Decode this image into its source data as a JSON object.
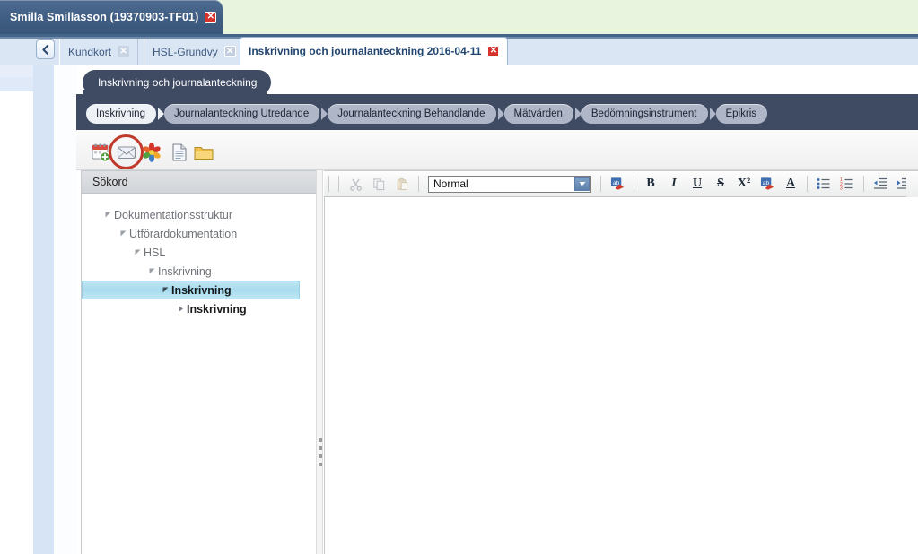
{
  "window": {
    "patient_tab": {
      "label": "Smilla Smillasson (19370903-TF01)",
      "close": "✕"
    }
  },
  "tabstrip": {
    "back_button": "back-chevron",
    "tabs": [
      {
        "label": "Kundkort",
        "close": "✕",
        "active": false
      },
      {
        "label": "HSL-Grundvy",
        "close": "✕",
        "active": false
      },
      {
        "label": "Inskrivning och journalanteckning 2016-04-11",
        "close": "✕",
        "active": true
      }
    ]
  },
  "header": {
    "title": "Inskrivning och journalanteckning",
    "steps": [
      {
        "label": "Inskrivning",
        "active": true
      },
      {
        "label": "Journalanteckning Utredande",
        "active": false
      },
      {
        "label": "Journalanteckning Behandlande",
        "active": false
      },
      {
        "label": "Mätvärden",
        "active": false
      },
      {
        "label": "Bedömningsinstrument",
        "active": false
      },
      {
        "label": "Epikris",
        "active": false
      }
    ]
  },
  "toolbar": {
    "icons": [
      {
        "name": "calendar-add-icon",
        "title": "Ny kalenderpost"
      },
      {
        "name": "envelope-icon",
        "title": "Meddelande",
        "highlighted": true
      },
      {
        "name": "asterisk-icon",
        "title": "Markera"
      },
      {
        "name": "document-icon",
        "title": "Dokument"
      },
      {
        "name": "folder-icon",
        "title": "Mapp"
      }
    ],
    "annotation_color": "#c0392b"
  },
  "tree_panel": {
    "header": "Sökord",
    "nodes": [
      {
        "label": "Dokumentationsstruktur",
        "indent": 0,
        "marker": "expanded",
        "selected": false,
        "strong": false
      },
      {
        "label": "Utförardokumentation",
        "indent": 1,
        "marker": "expanded",
        "selected": false,
        "strong": false
      },
      {
        "label": "HSL",
        "indent": 2,
        "marker": "expanded",
        "selected": false,
        "strong": false
      },
      {
        "label": "Inskrivning",
        "indent": 3,
        "marker": "expanded",
        "selected": false,
        "strong": false
      },
      {
        "label": "Inskrivning",
        "indent": 4,
        "marker": "expanded",
        "selected": true,
        "strong": true
      },
      {
        "label": "Inskrivning",
        "indent": 5,
        "marker": "collapsed",
        "selected": false,
        "strong": true
      }
    ]
  },
  "editor": {
    "style_select": {
      "value": "Normal",
      "placeholder": "Normal"
    },
    "buttons": [
      {
        "name": "cut-button",
        "glyph": "✂",
        "dim": true
      },
      {
        "name": "copy-button",
        "glyph": "❐",
        "dim": true
      },
      {
        "name": "paste-button",
        "glyph": "📋",
        "dim": true
      },
      {
        "name": "spellcheck-button",
        "glyph": "ab",
        "dim": false
      },
      {
        "name": "bold-button",
        "glyph": "B",
        "dim": false
      },
      {
        "name": "italic-button",
        "glyph": "I",
        "dim": false
      },
      {
        "name": "underline-button",
        "glyph": "U",
        "dim": false
      },
      {
        "name": "strikethrough-button",
        "glyph": "S",
        "dim": false
      },
      {
        "name": "superscript-button",
        "glyph": "X²",
        "dim": false
      },
      {
        "name": "highlight-color-button",
        "glyph": "ab",
        "dim": false
      },
      {
        "name": "font-color-button",
        "glyph": "A",
        "dim": false
      },
      {
        "name": "bullet-list-button",
        "glyph": "•≡",
        "dim": false
      },
      {
        "name": "numbered-list-button",
        "glyph": "1≡",
        "dim": false
      },
      {
        "name": "decrease-indent-button",
        "glyph": "⇤",
        "dim": false
      },
      {
        "name": "increase-indent-button",
        "glyph": "⇥",
        "dim": false
      },
      {
        "name": "align-button",
        "glyph": "≡",
        "dim": false
      }
    ],
    "content": ""
  },
  "colors": {
    "accent_blue": "#3f5d83",
    "header_dark": "#3f4a63",
    "selection": "#a8dcee",
    "annotation_red": "#c0392b",
    "top_band": "#e8f4de"
  }
}
